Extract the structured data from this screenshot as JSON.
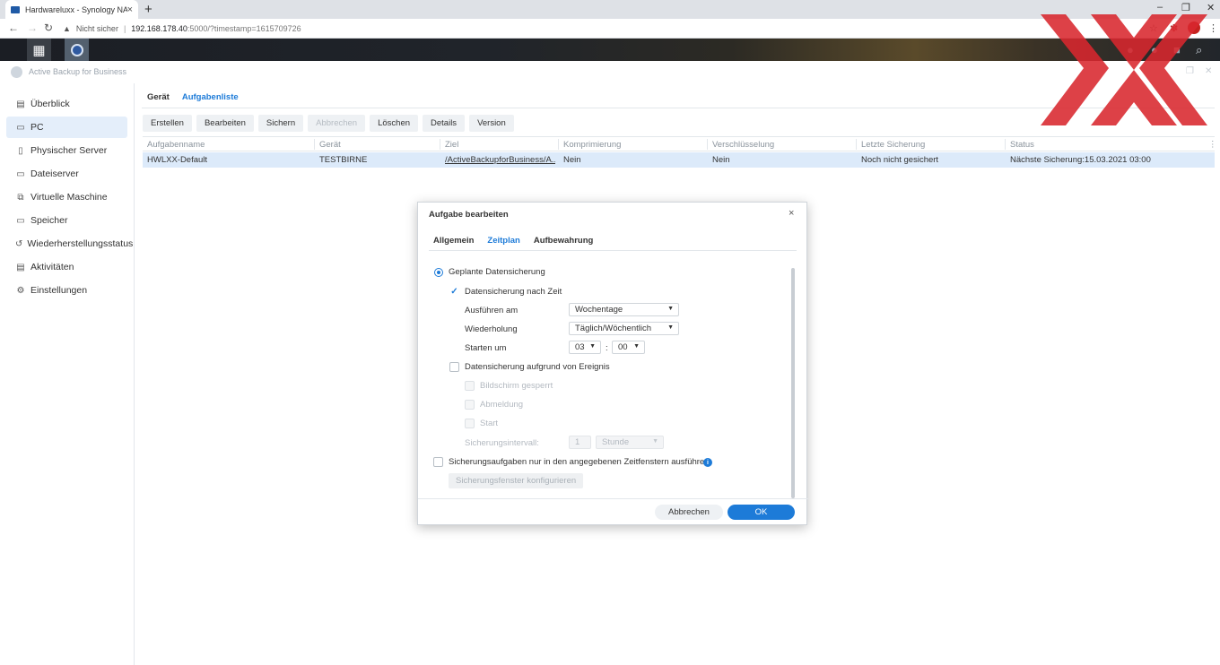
{
  "browser": {
    "tab_title": "Hardwareluxx - Synology NAS",
    "tab_close": "×",
    "new_tab": "+",
    "security_label": "Nicht sicher",
    "url_host": "192.168.178.40",
    "url_path": ":5000/?timestamp=1615709726",
    "window_controls": {
      "minimize": "–",
      "maximize": "❐",
      "close": "✕"
    }
  },
  "app": {
    "title": "Active Backup for Business"
  },
  "sidebar": {
    "items": [
      {
        "label": "Überblick",
        "icon": "overview-icon"
      },
      {
        "label": "PC",
        "icon": "pc-icon",
        "active": true
      },
      {
        "label": "Physischer Server",
        "icon": "server-icon"
      },
      {
        "label": "Dateiserver",
        "icon": "file-server-icon"
      },
      {
        "label": "Virtuelle Maschine",
        "icon": "vm-icon"
      },
      {
        "label": "Speicher",
        "icon": "storage-icon"
      },
      {
        "label": "Wiederherstellungsstatus",
        "icon": "restore-icon"
      },
      {
        "label": "Aktivitäten",
        "icon": "activity-icon"
      },
      {
        "label": "Einstellungen",
        "icon": "gear-icon"
      }
    ]
  },
  "main": {
    "tabs": [
      {
        "label": "Gerät"
      },
      {
        "label": "Aufgabenliste",
        "active": true
      }
    ],
    "toolbar": {
      "create": "Erstellen",
      "edit": "Bearbeiten",
      "backup": "Sichern",
      "cancel": "Abbrechen",
      "delete": "Löschen",
      "details": "Details",
      "version": "Version"
    },
    "table": {
      "headers": [
        "Aufgabenname",
        "Gerät",
        "Ziel",
        "Komprimierung",
        "Verschlüsselung",
        "Letzte Sicherung",
        "Status"
      ],
      "rows": [
        [
          "HWLXX-Default",
          "TESTBIRNE",
          "/ActiveBackupforBusiness/A...",
          "Nein",
          "Nein",
          "Noch nicht gesichert",
          "Nächste Sicherung:15.03.2021 03:00"
        ]
      ]
    }
  },
  "dialog": {
    "title": "Aufgabe bearbeiten",
    "close": "×",
    "tabs": [
      {
        "label": "Allgemein"
      },
      {
        "label": "Zeitplan",
        "active": true
      },
      {
        "label": "Aufbewahrung"
      }
    ],
    "scheduled_backup": "Geplante Datensicherung",
    "time_backup": "Datensicherung nach Zeit",
    "run_on_label": "Ausführen am",
    "run_on_value": "Wochentage",
    "repeat_label": "Wiederholung",
    "repeat_value": "Täglich/Wöchentlich",
    "start_label": "Starten um",
    "start_hour": "03",
    "time_sep": ":",
    "start_minute": "00",
    "event_backup": "Datensicherung aufgrund von Ereignis",
    "screen_locked": "Bildschirm gesperrt",
    "logout": "Abmeldung",
    "startup": "Start",
    "interval_label": "Sicherungsintervall:",
    "interval_value": "1",
    "interval_unit": "Stunde",
    "window_only": "Sicherungsaufgaben nur in den angegebenen Zeitfenstern ausführen",
    "info_glyph": "i",
    "configure_window": "Sicherungsfenster konfigurieren",
    "cancel_button": "Abbrechen",
    "ok_button": "OK"
  }
}
